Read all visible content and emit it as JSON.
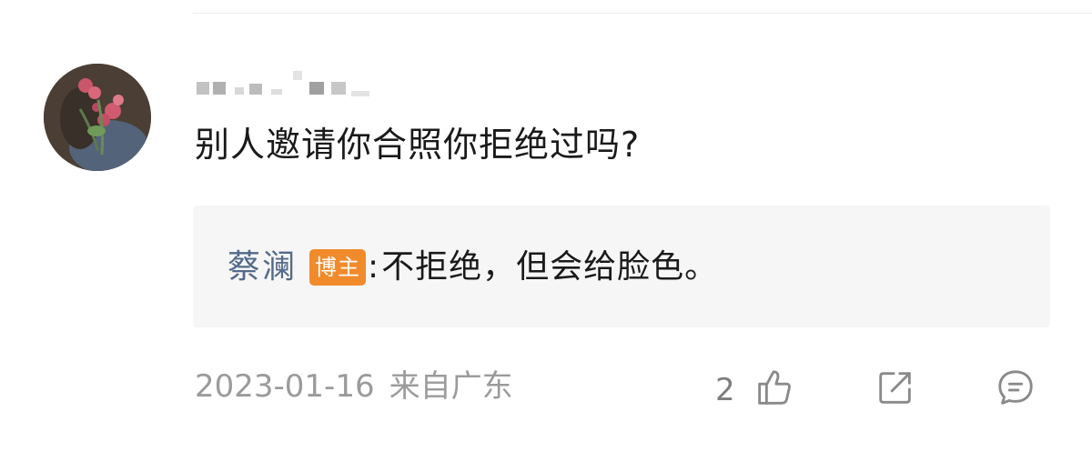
{
  "comment": {
    "text": "别人邀请你合照你拒绝过吗?",
    "username_obscured": true
  },
  "reply": {
    "author": "蔡澜",
    "badge": "博主",
    "separator": ":",
    "text": " 不拒绝，但会给脸色。"
  },
  "footer": {
    "date": "2023-01-16",
    "location": "来自广东",
    "like_count": "2"
  },
  "icons": {
    "like": "thumbs-up-icon",
    "share": "share-icon",
    "comment": "comment-icon"
  },
  "colors": {
    "author_link": "#536a8a",
    "badge_bg": "#f08a2b",
    "meta_gray": "#9b9b9b",
    "reply_bg": "#f6f6f6"
  }
}
